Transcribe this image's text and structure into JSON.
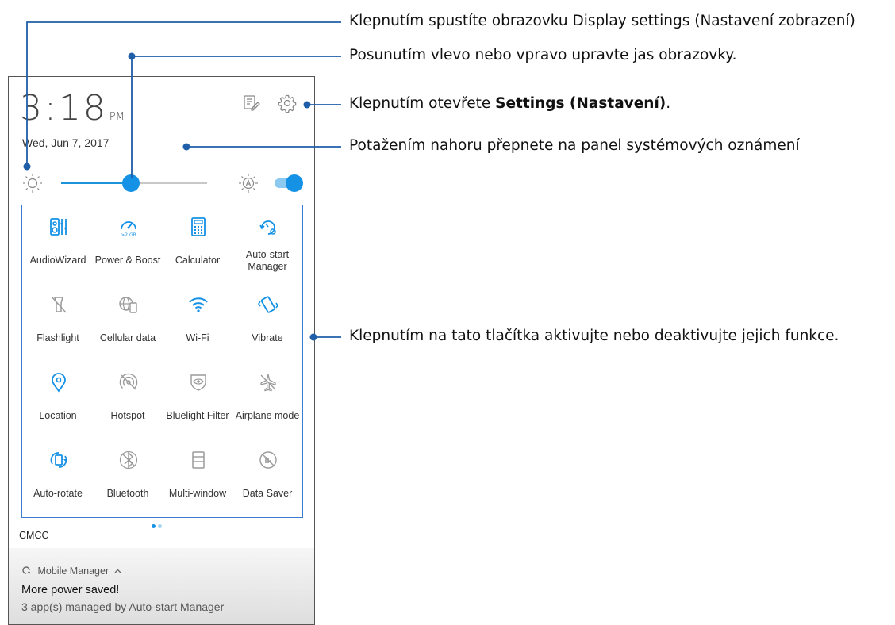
{
  "status": {
    "time": "3:18",
    "ampm": "PM",
    "date": "Wed, Jun 7, 2017"
  },
  "icons": {
    "edit": "edit-icon",
    "settings": "gear-icon",
    "brightness": "sun-icon",
    "auto_brightness": "auto-brightness-icon"
  },
  "brightness": {
    "level": 0.48,
    "auto_enabled": true
  },
  "tiles": [
    {
      "label": "AudioWizard",
      "icon": "audiowizard-icon",
      "active": true
    },
    {
      "label": "Power & Boost",
      "icon": "speedometer-icon",
      "active": true,
      "icon_text": ">2 GB"
    },
    {
      "label": "Calculator",
      "icon": "calculator-icon",
      "active": true
    },
    {
      "label": "Auto-start Manager",
      "icon": "auto-start-icon",
      "active": true
    },
    {
      "label": "Flashlight",
      "icon": "flashlight-icon",
      "active": false
    },
    {
      "label": "Cellular data",
      "icon": "globe-phone-icon",
      "active": false
    },
    {
      "label": "Wi-Fi",
      "icon": "wifi-icon",
      "active": true
    },
    {
      "label": "Vibrate",
      "icon": "vibrate-icon",
      "active": true
    },
    {
      "label": "Location",
      "icon": "location-pin-icon",
      "active": true
    },
    {
      "label": "Hotspot",
      "icon": "hotspot-icon",
      "active": false
    },
    {
      "label": "Bluelight Filter",
      "icon": "eye-shield-icon",
      "active": false
    },
    {
      "label": "Airplane mode",
      "icon": "airplane-icon",
      "active": false
    },
    {
      "label": "Auto-rotate",
      "icon": "auto-rotate-icon",
      "active": true
    },
    {
      "label": "Bluetooth",
      "icon": "bluetooth-icon",
      "active": false
    },
    {
      "label": "Multi-window",
      "icon": "multi-window-icon",
      "active": false
    },
    {
      "label": "Data Saver",
      "icon": "data-saver-icon",
      "active": false
    }
  ],
  "pager": {
    "pages": 2,
    "current": 1
  },
  "carrier": "CMCC",
  "notification": {
    "app": "Mobile Manager",
    "title": "More power saved!",
    "text": "3 app(s) managed by Auto-start Manager"
  },
  "colors": {
    "accent": "#1592e6",
    "icon_inactive": "#9a9a9a",
    "callout_line": "#1f5ea8"
  },
  "callouts": {
    "display_settings": "Klepnutím spustíte obrazovku Display settings (Nastavení zobrazení)",
    "brightness": "Posunutím vlevo nebo vpravo upravte jas obrazovky.",
    "settings_prefix": "Klepnutím otevřete ",
    "settings_bold": "Settings (Nastavení)",
    "settings_suffix": ".",
    "swipe_up": "Potažením nahoru přepnete na panel systémových oznámení",
    "tiles": "Klepnutím na tato tlačítka aktivujte nebo deaktivujte jejich funkce."
  }
}
